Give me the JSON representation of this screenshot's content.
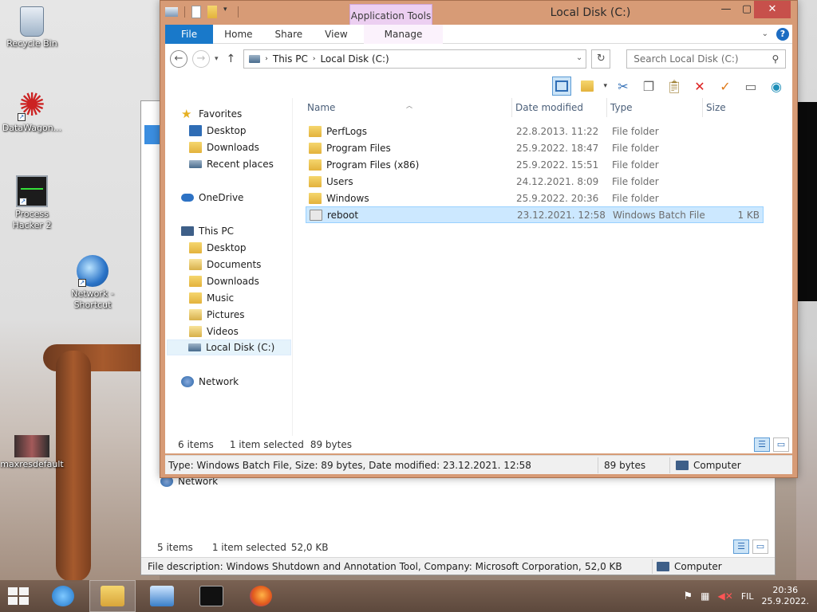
{
  "desktop": {
    "icons": [
      {
        "label": "Recycle Bin"
      },
      {
        "label": "DataWagon..."
      },
      {
        "label": "Process Hacker 2"
      },
      {
        "label": "Network - Shortcut"
      },
      {
        "label": "maxresdefault"
      }
    ]
  },
  "back_window": {
    "network_label": "Network",
    "status_items": "5 items",
    "status_selected": "1 item selected",
    "status_size": "52,0 KB",
    "details_text": "File description: Windows Shutdown and Annotation Tool, Company: Microsoft Corporation, File versic",
    "details_size": "52,0 KB",
    "details_location": "Computer"
  },
  "window": {
    "title": "Local Disk (C:)",
    "context_tab_group": "Application Tools",
    "ribbon_tabs": {
      "file": "File",
      "home": "Home",
      "share": "Share",
      "view": "View",
      "manage": "Manage"
    },
    "address": {
      "crumbs": [
        "This PC",
        "Local Disk (C:)"
      ]
    },
    "search": {
      "placeholder": "Search Local Disk (C:)"
    },
    "nav": {
      "favorites": "Favorites",
      "fav_desktop": "Desktop",
      "fav_downloads": "Downloads",
      "fav_recent": "Recent places",
      "onedrive": "OneDrive",
      "this_pc": "This PC",
      "pc_desktop": "Desktop",
      "pc_documents": "Documents",
      "pc_downloads": "Downloads",
      "pc_music": "Music",
      "pc_pictures": "Pictures",
      "pc_videos": "Videos",
      "pc_local_disk": "Local Disk (C:)",
      "network": "Network"
    },
    "columns": {
      "name": "Name",
      "date": "Date modified",
      "type": "Type",
      "size": "Size"
    },
    "files": [
      {
        "name": "PerfLogs",
        "date": "22.8.2013. 11:22",
        "type": "File folder",
        "size": ""
      },
      {
        "name": "Program Files",
        "date": "25.9.2022. 18:47",
        "type": "File folder",
        "size": ""
      },
      {
        "name": "Program Files (x86)",
        "date": "25.9.2022. 15:51",
        "type": "File folder",
        "size": ""
      },
      {
        "name": "Users",
        "date": "24.12.2021. 8:09",
        "type": "File folder",
        "size": ""
      },
      {
        "name": "Windows",
        "date": "25.9.2022. 20:36",
        "type": "File folder",
        "size": ""
      },
      {
        "name": "reboot",
        "date": "23.12.2021. 12:58",
        "type": "Windows Batch File",
        "size": "1 KB"
      }
    ],
    "status": {
      "items": "6 items",
      "selected": "1 item selected",
      "size": "89 bytes"
    },
    "details": {
      "text": "Type: Windows Batch File, Size: 89 bytes, Date modified: 23.12.2021. 12:58",
      "size": "89 bytes",
      "location": "Computer"
    }
  },
  "taskbar": {
    "language": "FIL",
    "time": "20:36",
    "date": "25.9.2022."
  },
  "colors": {
    "window_frame": "#d79b76",
    "file_tab": "#1979ca",
    "selection": "#cce8ff",
    "app_tools_tab": "#eccff1",
    "close_button": "#c7504b"
  }
}
